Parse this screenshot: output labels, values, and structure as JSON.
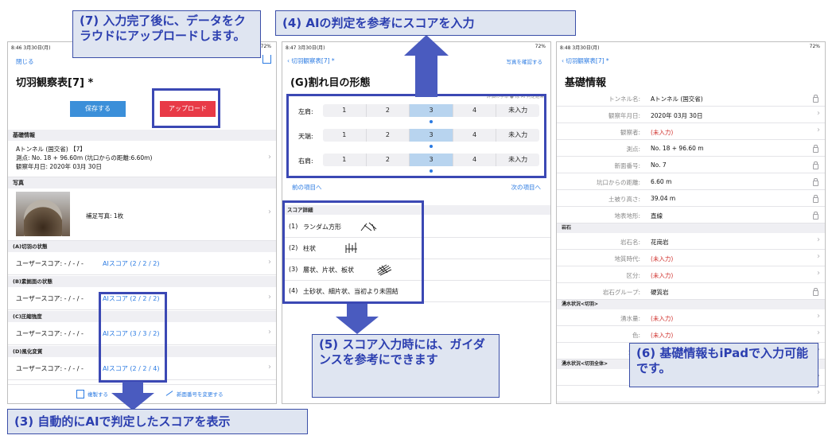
{
  "left": {
    "status_time": "8:46 3月30日(月)",
    "status_battery": "72%",
    "nav_close": "閉じる",
    "title": "切羽観察表[7] *",
    "save_label": "保存する",
    "upload_label": "アップロード",
    "basic_header": "基礎情報",
    "basic_line1": "Aトンネル (国交省) 【7】",
    "basic_line2": "測点: No. 18 + 96.60m (坑口からの距離:6.60m)",
    "basic_line3": "観察年月日: 2020年 03月 30日",
    "photo_header": "写真",
    "photo_caption": "補足写真: 1枚",
    "sections": [
      {
        "header": "(A)切羽の状態",
        "user": "ユーザースコア: - / - / -",
        "ai": "AIスコア (2 / 2 / 2)"
      },
      {
        "header": "(B)素掘面の状態",
        "user": "ユーザースコア: - / - / -",
        "ai": "AIスコア (2 / 2 / 2)"
      },
      {
        "header": "(C)圧縮強度",
        "user": "ユーザースコア: - / - / -",
        "ai": "AIスコア (3 / 3 / 2)"
      },
      {
        "header": "(D)風化変質",
        "user": "ユーザースコア: - / - / -",
        "ai": "AIスコア (2 / 2 / 4)"
      }
    ],
    "copy_label": "複製する",
    "renumber_label": "新面番号を変更する"
  },
  "middle": {
    "status_time": "8:47 3月30日(月)",
    "status_battery": "72%",
    "nav_back": "切羽観察表[7] *",
    "nav_photo": "写真を確認する",
    "title": "(G)割れ目の形態",
    "faint_note": "評価の手本 ● は AI 判定結果",
    "rows": [
      {
        "label": "左肩:",
        "options": [
          "1",
          "2",
          "3",
          "4",
          "未入力"
        ],
        "selected": 2
      },
      {
        "label": "天端:",
        "options": [
          "1",
          "2",
          "3",
          "4",
          "未入力"
        ],
        "selected": 2
      },
      {
        "label": "右肩:",
        "options": [
          "1",
          "2",
          "3",
          "4",
          "未入力"
        ],
        "selected": 2
      }
    ],
    "prev_label": "前の項目へ",
    "next_label": "次の項目へ",
    "detail_header": "スコア詳細",
    "details": [
      {
        "num": "(1)",
        "text": "ランダム方形",
        "icon": "random-crack-icon"
      },
      {
        "num": "(2)",
        "text": "柱状",
        "icon": "columnar-crack-icon"
      },
      {
        "num": "(3)",
        "text": "層状、片状、板状",
        "icon": "layered-crack-icon"
      },
      {
        "num": "(4)",
        "text": "土砂状、細片状、当初より未固結",
        "icon": ""
      }
    ]
  },
  "right": {
    "status_time": "8:48 3月30日(月)",
    "status_battery": "72%",
    "nav_back": "切羽観察表[7] *",
    "title": "基礎情報",
    "rows1": [
      {
        "label": "トンネル名:",
        "value": "Aトンネル (国交省)",
        "red": false,
        "icon": "lock"
      },
      {
        "label": "観察年月日:",
        "value": "2020年 03月 30日",
        "red": false,
        "icon": "chevron"
      },
      {
        "label": "観察者:",
        "value": "(未入力)",
        "red": true,
        "icon": "chevron"
      },
      {
        "label": "測点:",
        "value": "No. 18 + 96.60 m",
        "red": false,
        "icon": "lock"
      },
      {
        "label": "新面番号:",
        "value": "No. 7",
        "red": false,
        "icon": "lock"
      },
      {
        "label": "坑口からの距離:",
        "value": "6.60 m",
        "red": false,
        "icon": "lock"
      },
      {
        "label": "土被り高さ:",
        "value": "39.04 m",
        "red": false,
        "icon": "lock"
      },
      {
        "label": "地表地形:",
        "value": "直線",
        "red": false,
        "icon": "lock"
      }
    ],
    "rock_header": "岩石",
    "rows2": [
      {
        "label": "岩石名:",
        "value": "花崗岩",
        "red": false,
        "icon": "chevron"
      },
      {
        "label": "地質時代:",
        "value": "(未入力)",
        "red": true,
        "icon": "chevron"
      },
      {
        "label": "区分:",
        "value": "(未入力)",
        "red": true,
        "icon": "chevron"
      },
      {
        "label": "岩石グループ:",
        "value": "硬質岩",
        "red": false,
        "icon": "lock"
      }
    ],
    "water_header": "湧水状況<切羽>",
    "rows3": [
      {
        "label": "湧水量:",
        "value": "(未入力)",
        "red": true,
        "icon": "chevron"
      },
      {
        "label": "色:",
        "value": "(未入力)",
        "red": true,
        "icon": "chevron"
      },
      {
        "label": "湧水",
        "value": "",
        "red": false,
        "icon": "chevron"
      }
    ],
    "water_header2": "湧水状況<切羽全体>",
    "rows4": [
      {
        "label": "湧",
        "value": "",
        "red": false,
        "icon": "chevron"
      },
      {
        "label": "",
        "value": "",
        "red": false,
        "icon": "chevron"
      },
      {
        "label": "色:",
        "value": "(未入力)",
        "red": true,
        "icon": "chevron"
      }
    ]
  },
  "callouts": {
    "c7": "(7) 入力完了後に、データをクラウドにアップロードします。",
    "c4": "(4) AIの判定を参考にスコアを入力",
    "c5": "(5) スコア入力時には、ガイダンスを参考にできます",
    "c6": "(6) 基礎情報もiPadで入力可能です。",
    "c3": "(3) 自動的にAIで判定したスコアを表示"
  },
  "colors": {
    "accent": "#2a7ae2",
    "save": "#3b8fd9",
    "upload": "#e83a47",
    "callout_text": "#2c3fb0",
    "highlight": "#3b48b4"
  }
}
